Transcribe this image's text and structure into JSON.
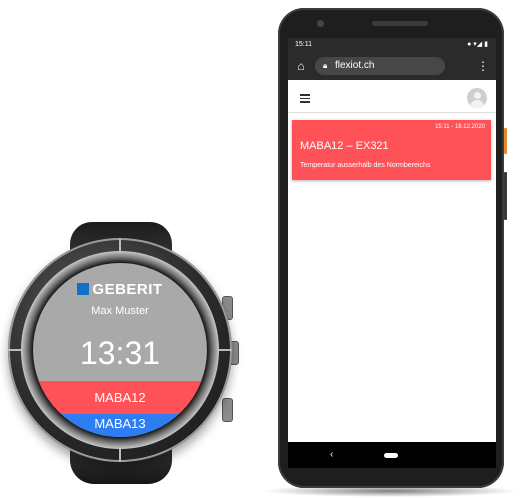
{
  "watch": {
    "logo": "GEBERIT",
    "user_name": "Max Muster",
    "time": "13:31",
    "alerts": [
      {
        "label": "MABA12",
        "color": "#ff5258"
      },
      {
        "label": "MABA13",
        "color": "#2f7df3"
      }
    ]
  },
  "phone": {
    "status_time": "15:11",
    "status_icons": "● ▾◢ ▮",
    "url": "flexiot.ch",
    "home_icon": "home-icon",
    "menu_icon": "more-vert-icon",
    "notification": {
      "timestamp": "15:11 - 18.12.2020",
      "title": "MABA12 – EX321",
      "message": "Temperatur ausserhalb des Normbereichs",
      "color": "#ff5258"
    },
    "nav_back": "‹"
  },
  "colors": {
    "alert_red": "#ff5258",
    "alert_blue": "#2f7df3",
    "brand_blue": "#0f72c8"
  }
}
